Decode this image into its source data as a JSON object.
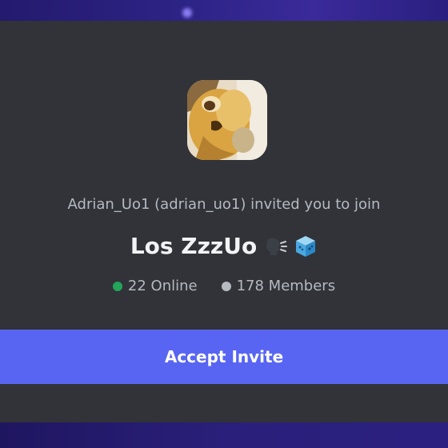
{
  "invite": {
    "inviter_text": "Adrian_Uo1 (adrian_uo1) invited you to join",
    "server_name": "Los ZzzUo",
    "server_emojis": [
      "speaking-head-icon",
      "ice-cube-icon"
    ],
    "online_count_text": "22 Online",
    "members_count_text": "178 Members",
    "accept_label": "Accept Invite"
  },
  "colors": {
    "card_background": "#313338",
    "accent_button": "#5865f2",
    "online_dot": "#23a55a",
    "members_dot": "#b5bac1",
    "backdrop": "#2a1f7a"
  }
}
